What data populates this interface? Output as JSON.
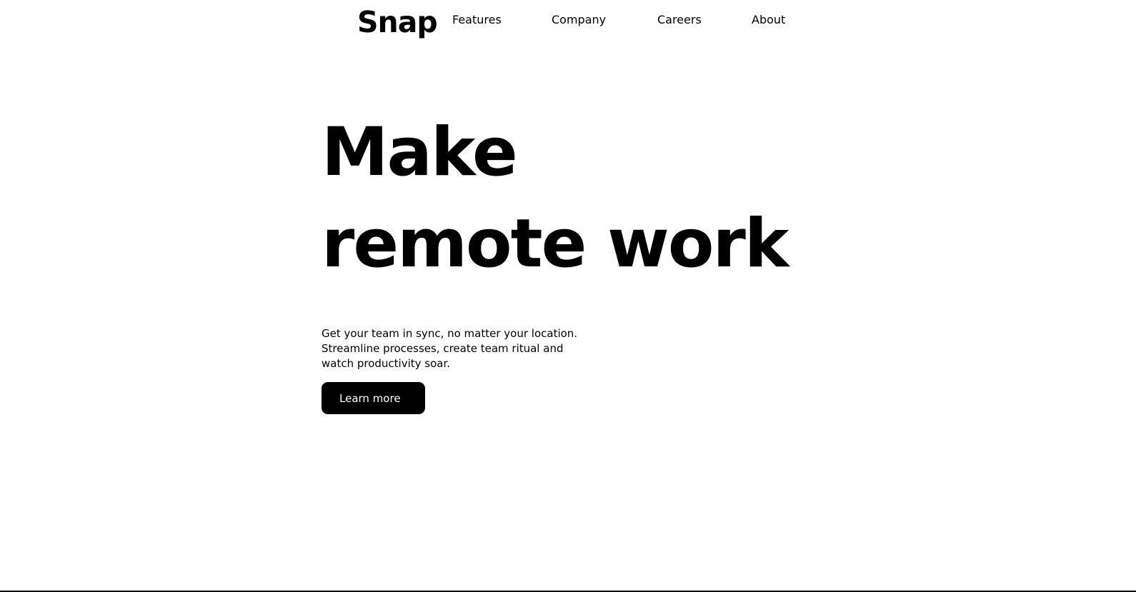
{
  "header": {
    "logo": "Snap",
    "nav": {
      "features": "Features",
      "company": "Company",
      "careers": "Careers",
      "about": "About"
    }
  },
  "hero": {
    "title_line1": "Make",
    "title_line2": "remote work",
    "description_line1": "Get your team in sync, no matter your location.",
    "description_line2": "Streamline processes, create team ritual and",
    "description_line3": "watch productivity soar.",
    "cta_label": "Learn more"
  },
  "colors": {
    "text": "#000000",
    "background": "#ffffff",
    "button_bg": "#000000",
    "button_text": "#ffffff"
  }
}
